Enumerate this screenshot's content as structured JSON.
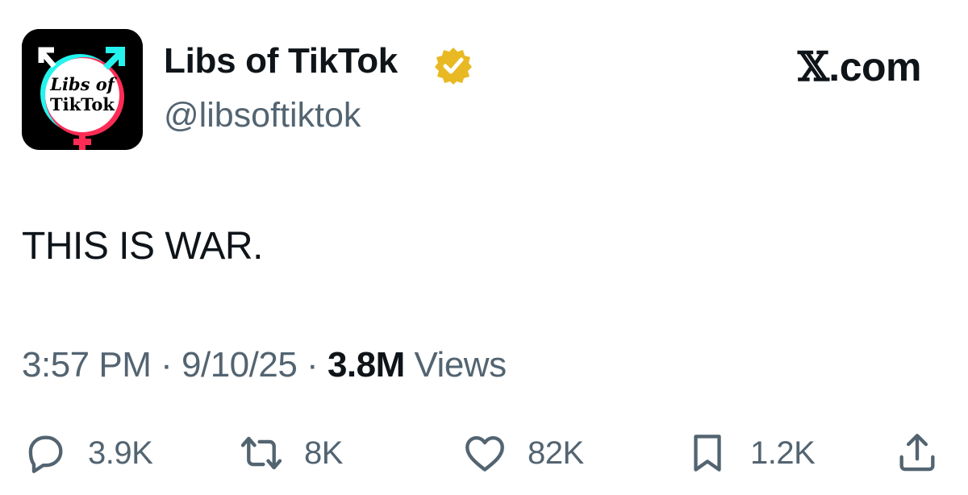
{
  "author": {
    "display_name": "Libs of TikTok",
    "handle": "@libsoftiktok",
    "verified_badge_color": "#e8b923",
    "avatar": {
      "logo_text_line1": "Libs of",
      "logo_text_line2": "TikTok",
      "ring_colors": [
        "#25f4ee",
        "#fe2c55"
      ]
    }
  },
  "brand": {
    "logo_glyph": "𝕏",
    "suffix": ".com"
  },
  "tweet": {
    "text": "THIS IS WAR."
  },
  "meta": {
    "time": "3:57 PM",
    "separator": "·",
    "date": "9/10/25",
    "views_count": "3.8M",
    "views_label": "Views"
  },
  "actions": {
    "reply_count": "3.9K",
    "retweet_count": "8K",
    "like_count": "82K",
    "bookmark_count": "1.2K"
  },
  "colors": {
    "primary_text": "#0f1419",
    "secondary_text": "#536471"
  }
}
